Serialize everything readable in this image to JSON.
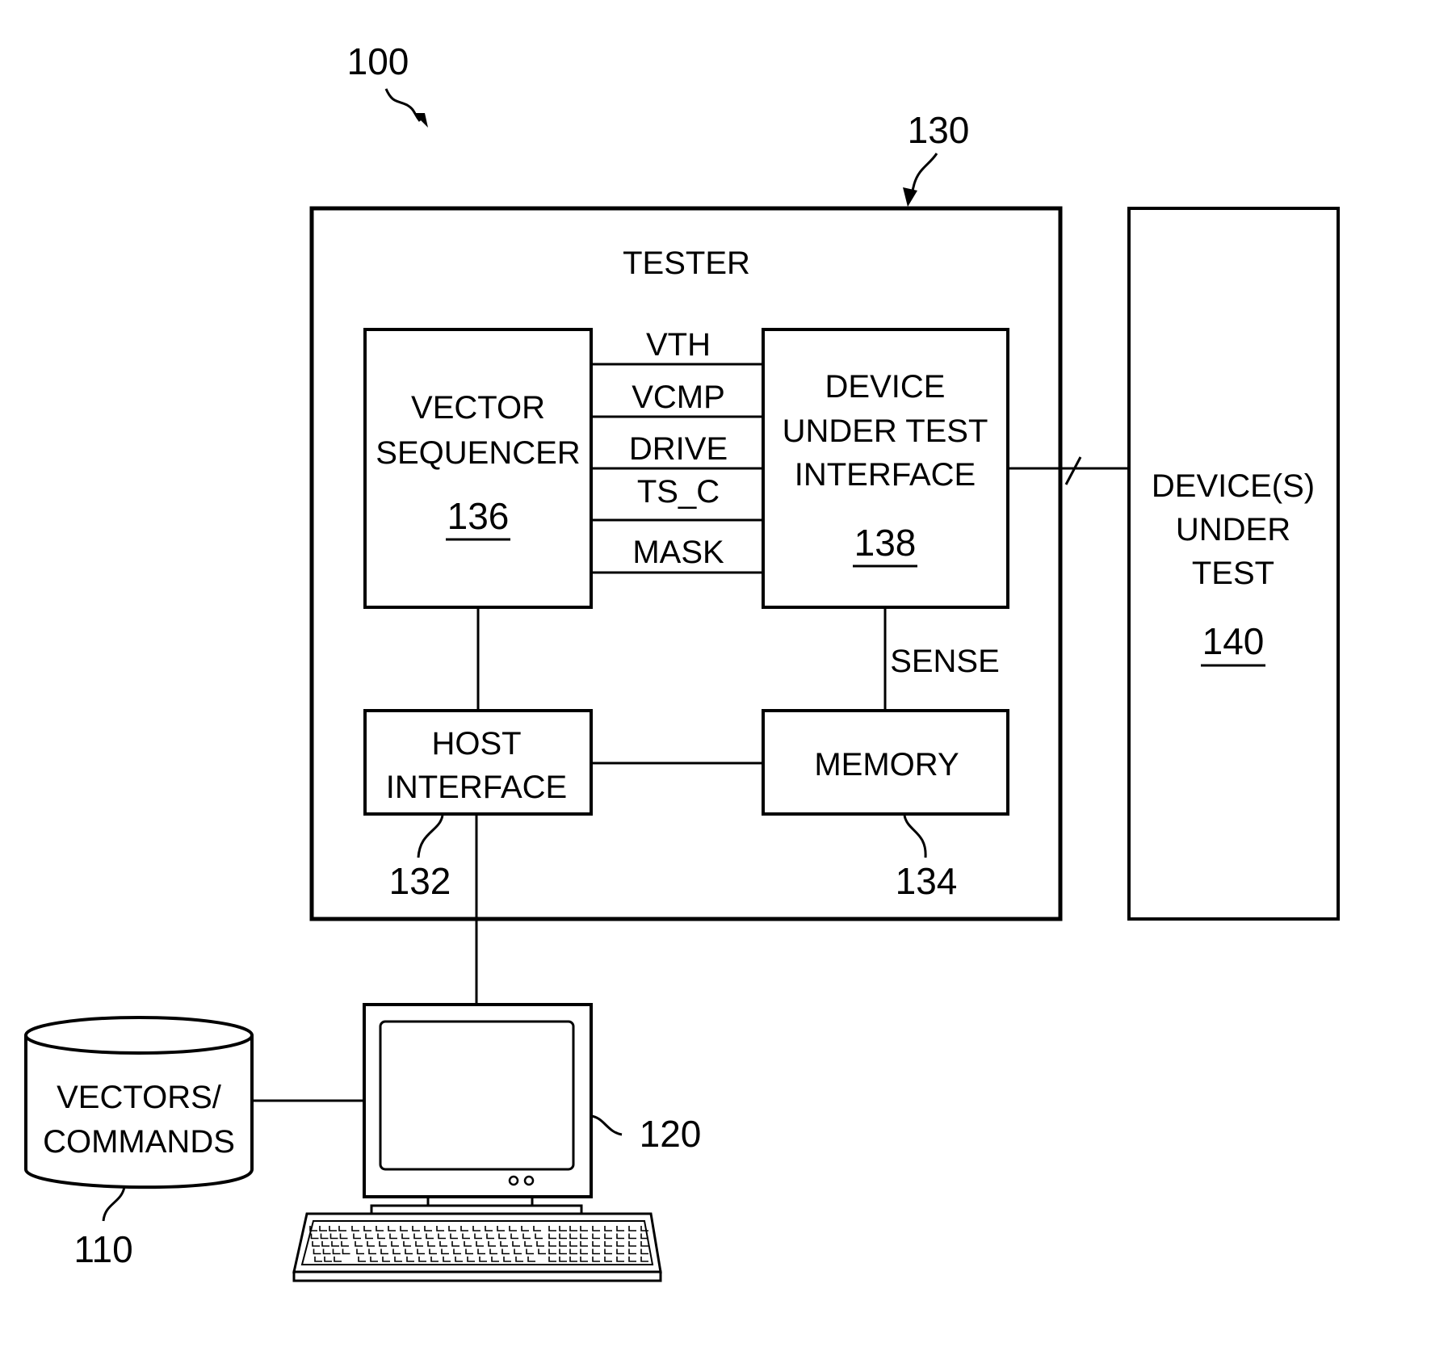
{
  "figure": {
    "system_ref": "100",
    "tester": {
      "title": "TESTER",
      "ref": "130"
    },
    "vector_sequencer": {
      "lines": [
        "VECTOR",
        "SEQUENCER"
      ],
      "ref": "136"
    },
    "dut_interface": {
      "lines": [
        "DEVICE",
        "UNDER TEST",
        "INTERFACE"
      ],
      "ref": "138"
    },
    "host_interface": {
      "lines": [
        "HOST",
        "INTERFACE"
      ],
      "ref": "132"
    },
    "memory": {
      "lines": [
        "MEMORY"
      ],
      "ref": "134"
    },
    "devices_under_test": {
      "lines": [
        "DEVICE(S)",
        "UNDER",
        "TEST"
      ],
      "ref": "140"
    },
    "vectors_store": {
      "lines": [
        "VECTORS/",
        "COMMANDS"
      ],
      "ref": "110"
    },
    "computer": {
      "ref": "120"
    },
    "signals": [
      "VTH",
      "VCMP",
      "DRIVE",
      "TS_C",
      "MASK"
    ],
    "sense_label": "SENSE",
    "colors": {
      "ink": "#000000",
      "paper": "#ffffff"
    }
  }
}
